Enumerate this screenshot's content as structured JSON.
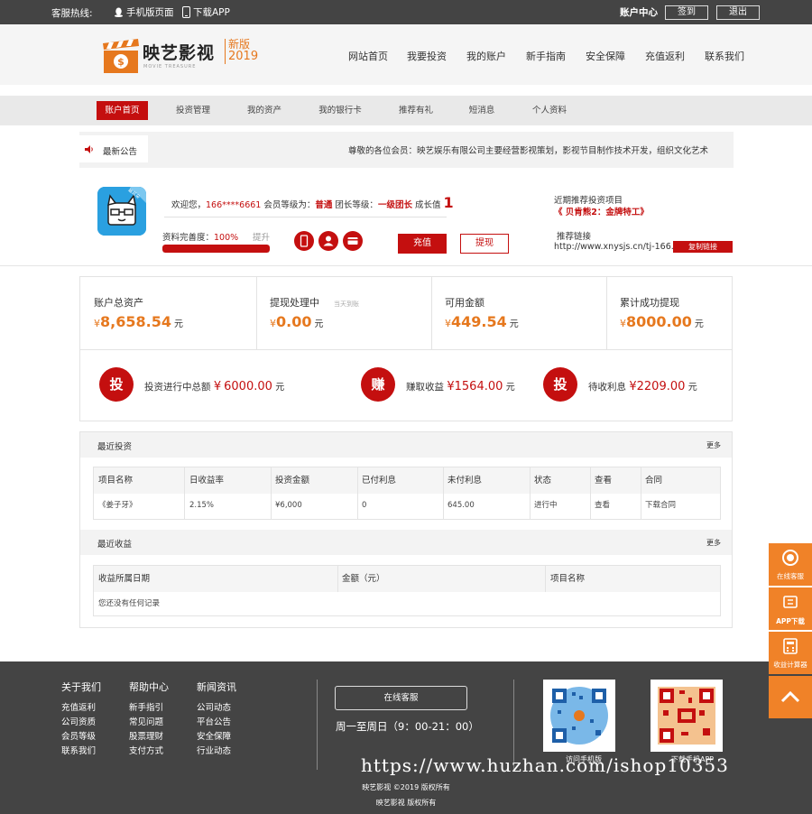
{
  "topbar": {
    "hotline": "客服热线:",
    "mobile": "手机版页面",
    "app": "下载APP",
    "ucenter": "账户中心",
    "signin": "签到",
    "logout": "退出"
  },
  "logo": {
    "brand": "映艺影视",
    "sub": "MOVIE TREASURE",
    "badge_new": "新版",
    "badge_year": "2019"
  },
  "nav": [
    "网站首页",
    "我要投资",
    "我的账户",
    "新手指南",
    "安全保障",
    "充值返利",
    "联系我们"
  ],
  "subnav": [
    "账户首页",
    "投资管理",
    "我的资产",
    "我的银行卡",
    "推荐有礼",
    "短消息",
    "个人资料"
  ],
  "notice": {
    "tab": "最新公告",
    "text": "尊敬的各位会员：映艺娱乐有限公司主要经营影视策划，影视节目制作技术开发，组织文化艺术"
  },
  "profile": {
    "welcome": "欢迎您，",
    "phone": "166****6661",
    "member_label": "会员等级为：",
    "member_level": "普通",
    "team_label": "团长等级：",
    "team_level": "一级团长",
    "growth_label": "成长值",
    "growth_value": "1",
    "complete_label": "资料完善度：",
    "complete_value": "100%",
    "complete_fraction": 1.0,
    "upgrade": "提升",
    "recharge": "充值",
    "withdraw": "提现",
    "rec_label": "近期推荐投资项目",
    "rec_title": "《 贝肯熊2：金牌特工》",
    "link_label": "推荐链接",
    "link_url": "http://www.xnysjs.cn/tj-166...",
    "copy": "复制链接",
    "avatar_badge": "猫耳朵"
  },
  "assets": {
    "cells": [
      {
        "label": "账户总资产",
        "note": "",
        "value": "8,658.54",
        "unit": "元"
      },
      {
        "label": "提现处理中",
        "note": "当天到账",
        "value": "0.00",
        "unit": "元"
      },
      {
        "label": "可用金额",
        "note": "",
        "value": "449.54",
        "unit": "元"
      },
      {
        "label": "累计成功提现",
        "note": "",
        "value": "8000.00",
        "unit": "元"
      }
    ],
    "currency": "¥",
    "stats": [
      {
        "icon": "投",
        "label": "投资进行中总额",
        "value": "6000.00",
        "unit": "元"
      },
      {
        "icon": "赚",
        "label": "赚取收益",
        "value": "1564.00",
        "unit": "元"
      },
      {
        "icon": "投",
        "label": "待收利息",
        "value": "2209.00",
        "unit": "元"
      }
    ]
  },
  "recent_invest": {
    "title": "最近投资",
    "more": "更多",
    "headers": [
      "项目名称",
      "日收益率",
      "投资金额",
      "已付利息",
      "未付利息",
      "状态",
      "查看",
      "合同"
    ],
    "rows": [
      [
        "《姜子牙》",
        "2.15%",
        "¥6,000",
        "0",
        "645.00",
        "进行中",
        "查看",
        "下载合同"
      ]
    ]
  },
  "recent_income": {
    "title": "最近收益",
    "more": "更多",
    "headers": [
      "收益所属日期",
      "金额（元）",
      "项目名称"
    ],
    "empty": "您还没有任何记录"
  },
  "footer": {
    "cols": [
      {
        "title": "关于我们",
        "items": [
          "充值返利",
          "公司资质",
          "会员等级",
          "联系我们"
        ]
      },
      {
        "title": "帮助中心",
        "items": [
          "新手指引",
          "常见问题",
          "股票理财",
          "支付方式"
        ]
      },
      {
        "title": "新闻资讯",
        "items": [
          "公司动态",
          "平台公告",
          "安全保障",
          "行业动态"
        ]
      }
    ],
    "service": "在线客服",
    "hours": "周一至周日（9：00-21：00）",
    "qr1_label": "访问手机版",
    "qr2_label": "下载手机APP",
    "copyright": "映艺影视 ©2019 版权所有",
    "copyright2": "映艺影视  版权所有",
    "watermark": "https://www.huzhan.com/ishop10353"
  },
  "side": {
    "service": "在线客服",
    "app": "APP下载",
    "calc": "收益计算器"
  },
  "colors": {
    "accent": "#c40f0f",
    "orange": "#e6781e",
    "side": "#f08228",
    "dark": "#444444"
  }
}
